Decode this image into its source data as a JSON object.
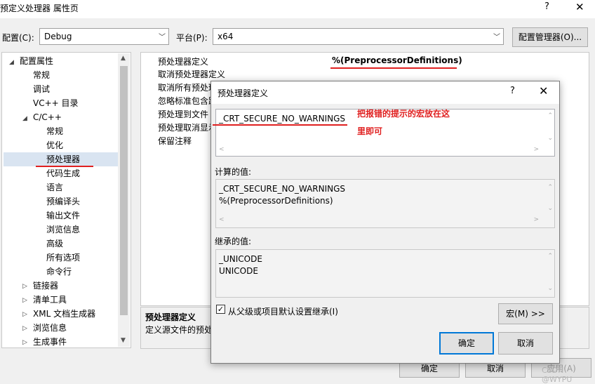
{
  "window": {
    "title": "预定义处理器 属性页",
    "help": "?",
    "close": "✕"
  },
  "config": {
    "config_label": "配置(C):",
    "config_value": "Debug",
    "platform_label": "平台(P):",
    "platform_value": "x64",
    "manager_button": "配置管理器(O)..."
  },
  "tree": {
    "items": [
      {
        "label": "配置属性",
        "toggle": "◢"
      },
      {
        "label": "常规"
      },
      {
        "label": "调试"
      },
      {
        "label": "VC++ 目录"
      },
      {
        "label": "C/C++",
        "toggle": "◢"
      },
      {
        "label": "常规"
      },
      {
        "label": "优化"
      },
      {
        "label": "预处理器"
      },
      {
        "label": "代码生成"
      },
      {
        "label": "语言"
      },
      {
        "label": "预编译头"
      },
      {
        "label": "输出文件"
      },
      {
        "label": "浏览信息"
      },
      {
        "label": "高级"
      },
      {
        "label": "所有选项"
      },
      {
        "label": "命令行"
      },
      {
        "label": "链接器",
        "toggle": "▷"
      },
      {
        "label": "清单工具",
        "toggle": "▷"
      },
      {
        "label": "XML 文档生成器",
        "toggle": "▷"
      },
      {
        "label": "浏览信息",
        "toggle": "▷"
      },
      {
        "label": "生成事件",
        "toggle": "▷"
      }
    ]
  },
  "grid": {
    "rows": [
      "预处理器定义",
      "取消预处理器定义",
      "取消所有预处理",
      "忽略标准包含路",
      "预处理到文件",
      "预处理取消显示",
      "保留注释"
    ],
    "first_value": "%(PreprocessorDefinitions)"
  },
  "description": {
    "heading": "预处理器定义",
    "body": "定义源文件的预处"
  },
  "main_buttons": {
    "ok": "确定",
    "cancel": "取消",
    "apply": "应用(A)"
  },
  "dialog": {
    "title": "预处理器定义",
    "help": "?",
    "close": "✕",
    "input_value": "_CRT_SECURE_NO_WARNINGS",
    "evaluated_label": "计算的值:",
    "evaluated_value": "_CRT_SECURE_NO_WARNINGS\n%(PreprocessorDefinitions)",
    "inherited_label": "继承的值:",
    "inherited_value": "_UNICODE\nUNICODE",
    "inherit_checkbox": "从父级或项目默认设置继承(I)",
    "inherit_checked": true,
    "macros_button": "宏(M) >>",
    "ok": "确定",
    "cancel": "取消"
  },
  "annotation": {
    "line1": "把报错的提示的宏放在这",
    "line2": "里即可",
    "color": "#e02020"
  },
  "watermark": "CSDN @WYPU"
}
